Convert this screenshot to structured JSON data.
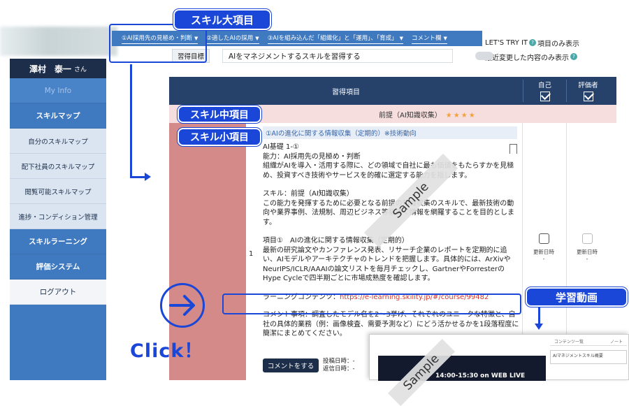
{
  "sidebar": {
    "user_name": "澤村　泰一",
    "user_suffix": "さん",
    "items": [
      {
        "label": "My Info"
      },
      {
        "label": "スキルマップ"
      },
      {
        "label": "自分のスキルマップ"
      },
      {
        "label": "配下社員のスキルマップ"
      },
      {
        "label": "閲覧可能スキルマップ"
      },
      {
        "label": "進捗・コンディション管理"
      },
      {
        "label": "スキルラーニング"
      },
      {
        "label": "評価システム"
      },
      {
        "label": "ログアウト"
      }
    ]
  },
  "topbar": {
    "dropdowns": [
      {
        "label": "①AI採用先の見極め・判断"
      },
      {
        "label": "②適したAIの採用"
      },
      {
        "label": "③AIを組み込んだ「組織化」と「運用」、「育成」"
      },
      {
        "label": "コメント欄"
      }
    ],
    "caret": "▼"
  },
  "options": {
    "lets_try": "LET'S TRY IT",
    "lets_try_suffix": "項目のみ表示",
    "recent_changes": "最近変更した内容のみ表示",
    "help_glyph": "?"
  },
  "goal": {
    "label": "習得目標",
    "value": "AIをマネジメントするスキルを習得する"
  },
  "table": {
    "header_title": "習得項目",
    "col_self": "自己",
    "col_eval": "評価者",
    "mid_item": "前提（AI知識収集）",
    "mid_stars": "★★★★",
    "small_item": "①AIの進化に関する情報収集（定期的）※技術動向",
    "row_number": "1",
    "desc_heading": "AI基礎 1-①",
    "desc_ability": "能力：AI採用先の見極め・判断\n組織がAIを導入・活用する際に、どの領域で自社に最も価値をもたらすかを見極め、投資すべき技術やサービスを的確に選定する能力を指します。",
    "desc_skill": "スキル：前提（AI知識収集）\nこの能力を発揮するために必要となる前提の知識収集のスキルで、最新技術の動向や業界事例、法規制、周辺ビジネス等幅広く情報を網羅することを目的とします。",
    "desc_item": "項目①　AIの進化に関する情報収集（定期的）\n最新の研究論文やカンファレンス発表、リサーチ企業のレポートを定期的に追い、AIモデルやアーキテクチャのトレンドを把握します。具体的には、ArXivやNeurIPS/ICLR/AAAIの論文リストを毎月チェックし、GartnerやForresterのHype Cycleで四半期ごとに市場成熟度を確認します。",
    "learning_label": "ラーニングコンテンツ：",
    "learning_url": "https://e-learning.skility.jp/#/course/99482",
    "comment_text": "コメント事項：調査したモデル名を2～3挙げ、それぞれのユニークな特徴と、自社の具体的業務（例：画像検査、需要予測など）にどう活かせるかを1段落程度に簡潔にまとめてください。",
    "comment_button": "コメントをする",
    "posted_at": "投稿日時：-",
    "replied_at": "返信日時：-",
    "self_update": "更新日時",
    "self_update_value": "-",
    "eval_update": "更新日時",
    "eval_update_value": "-"
  },
  "annotations": {
    "big": "スキル大項目",
    "mid": "スキル中項目",
    "small": "スキル小項目",
    "video": "学習動画",
    "click": "Click！",
    "arrow_glyph": "→",
    "watermark": "Sample"
  },
  "video": {
    "time": "14:00-15:30 on WEB LIVE",
    "tab_contents": "コンテンツ一覧",
    "tab_note": "ノート",
    "item": "AIマネジメントスキル概要"
  },
  "colors": {
    "accent": "#1a47d8",
    "sidebar": "#3f79bf",
    "header": "#26426b",
    "mid_row": "#f6dede",
    "pink_col": "#d48a88",
    "link": "#d4362e"
  }
}
